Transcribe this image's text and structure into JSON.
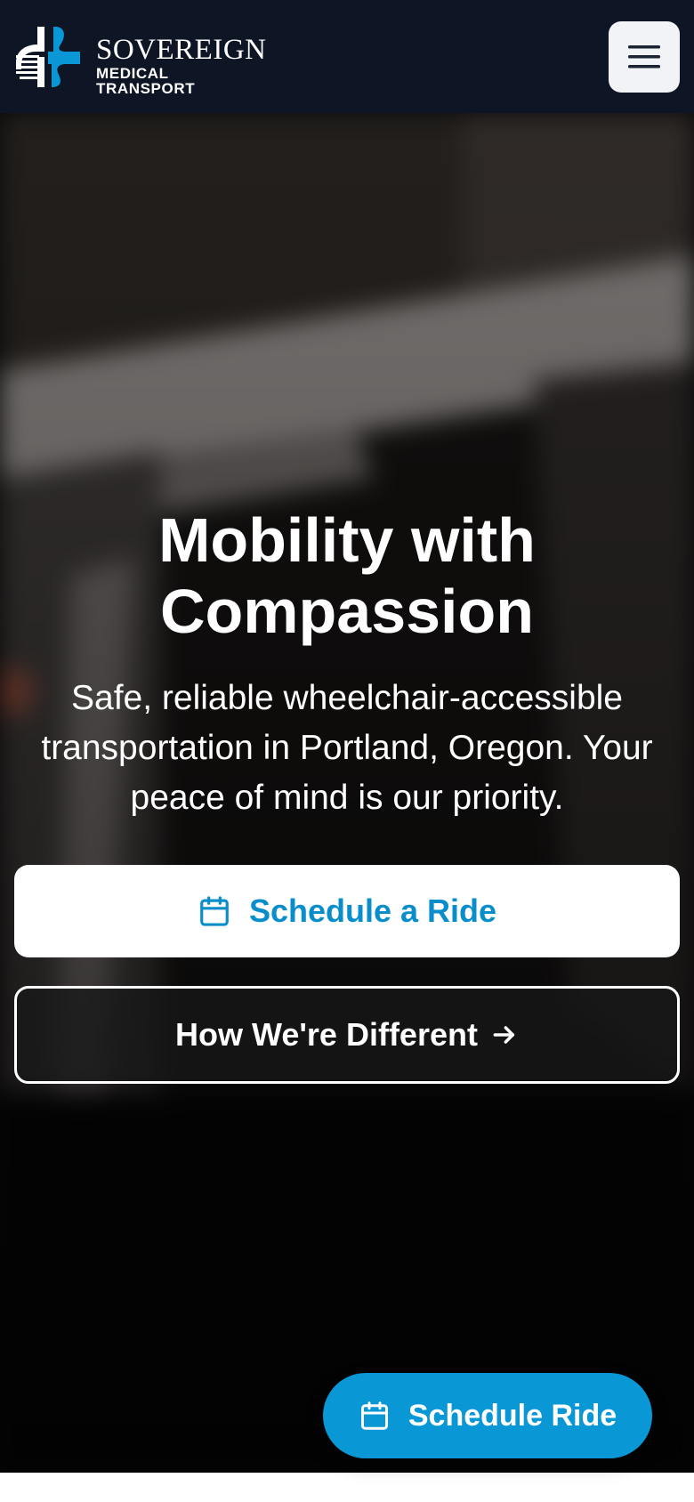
{
  "brand": {
    "name": "SOVEREIGN",
    "tagline": "MEDICAL TRANSPORT",
    "accent_color": "#0a97d6",
    "header_color": "#0e1626"
  },
  "header": {
    "menu_icon": "hamburger-menu-icon"
  },
  "hero": {
    "title": "Mobility with Compassion",
    "subtitle": "Safe, reliable wheelchair-accessible transportation in Portland, Oregon. Your peace of mind is our priority.",
    "primary_cta": {
      "label": "Schedule a Ride",
      "icon": "calendar-icon"
    },
    "secondary_cta": {
      "label": "How We're Different",
      "icon": "arrow-right-icon"
    }
  },
  "floating_cta": {
    "label": "Schedule Ride",
    "icon": "calendar-icon"
  }
}
